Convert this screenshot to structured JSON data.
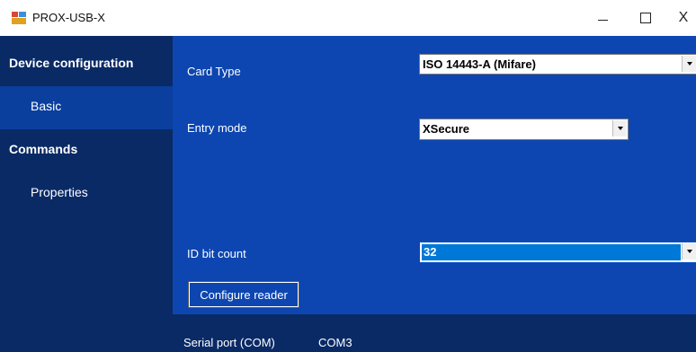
{
  "window": {
    "title": "PROX-USB-X",
    "minimize_icon": "minimize-icon",
    "maximize_icon": "maximize-icon",
    "close_glyph": "X"
  },
  "sidebar": {
    "items": [
      {
        "label": "Device configuration",
        "type": "header"
      },
      {
        "label": "Basic",
        "type": "item",
        "selected": true
      },
      {
        "label": "Commands",
        "type": "header"
      },
      {
        "label": "Properties",
        "type": "item"
      }
    ]
  },
  "form": {
    "card_type": {
      "label": "Card Type",
      "value": "ISO 14443-A (Mifare)"
    },
    "entry_mode": {
      "label": "Entry mode",
      "value": "XSecure"
    },
    "id_bit_count": {
      "label": "ID bit count",
      "value": "32"
    },
    "configure_button": "Configure reader"
  },
  "status": {
    "label": "Serial port (COM)",
    "value": "COM3"
  },
  "colors": {
    "sidebar": "#0a2a66",
    "sidebar_selected": "#0a3f9e",
    "main": "#0d46b0",
    "selection": "#0078d7"
  }
}
